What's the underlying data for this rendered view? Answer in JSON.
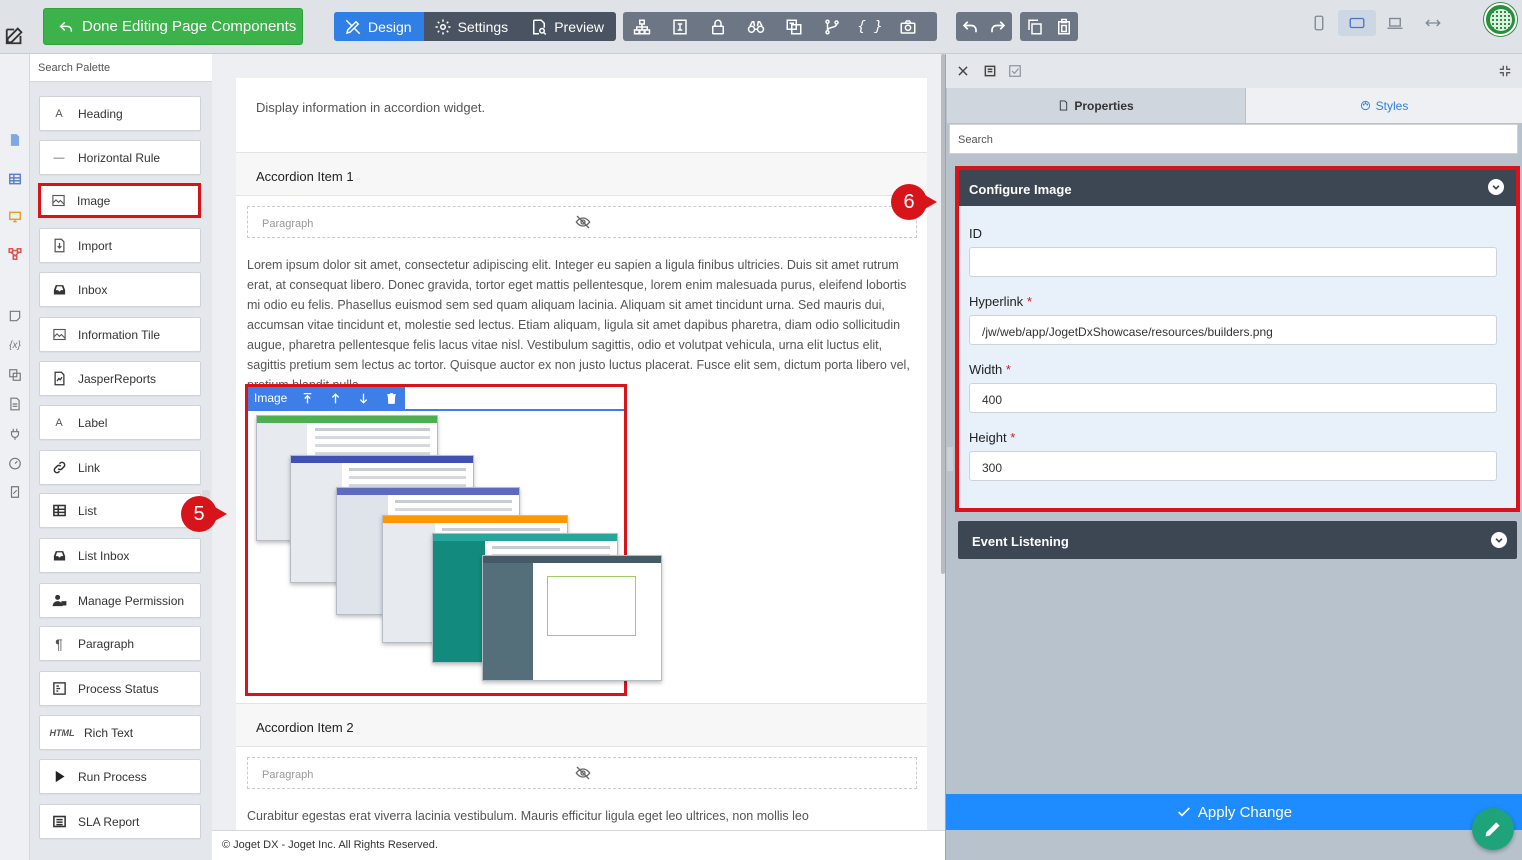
{
  "topbar": {
    "done_label": "Done Editing Page Components",
    "modes": [
      {
        "label": "Design",
        "active": true
      },
      {
        "label": "Settings",
        "active": false
      },
      {
        "label": "Preview",
        "active": false
      }
    ],
    "tools": [
      "sitemap-icon",
      "form-icon",
      "lock-icon",
      "binoculars-icon",
      "translate-icon",
      "branch-icon",
      "code-braces-icon",
      "camera-icon"
    ],
    "history_tools": [
      "undo-icon",
      "redo-icon"
    ],
    "clipboard_tools": [
      "copy-icon",
      "paste-icon"
    ],
    "devices": [
      "phone-icon",
      "tablet-icon",
      "laptop-icon",
      "expand-icon"
    ],
    "active_device": "tablet-icon",
    "accent_color": "#2f7fe6",
    "done_color": "#3bb34a"
  },
  "palette": {
    "search_placeholder": "Search Palette",
    "items": [
      {
        "label": "Heading",
        "icon": "heading-icon",
        "glyph": "A"
      },
      {
        "label": "Horizontal Rule",
        "icon": "horizontal-rule-icon",
        "glyph": "—"
      },
      {
        "label": "Image",
        "icon": "image-icon",
        "glyph": ""
      },
      {
        "label": "Import",
        "icon": "import-icon",
        "glyph": ""
      },
      {
        "label": "Inbox",
        "icon": "inbox-icon",
        "glyph": ""
      },
      {
        "label": "Information Tile",
        "icon": "information-tile-icon",
        "glyph": ""
      },
      {
        "label": "JasperReports",
        "icon": "jasperreports-icon",
        "glyph": ""
      },
      {
        "label": "Label",
        "icon": "label-icon",
        "glyph": "A"
      },
      {
        "label": "Link",
        "icon": "link-icon",
        "glyph": ""
      },
      {
        "label": "List",
        "icon": "list-icon",
        "glyph": ""
      },
      {
        "label": "List Inbox",
        "icon": "list-inbox-icon",
        "glyph": ""
      },
      {
        "label": "Manage Permission",
        "icon": "manage-permission-icon",
        "glyph": ""
      },
      {
        "label": "Paragraph",
        "icon": "paragraph-icon",
        "glyph": "¶"
      },
      {
        "label": "Process Status",
        "icon": "process-status-icon",
        "glyph": ""
      },
      {
        "label": "Rich Text",
        "icon": "rich-text-icon",
        "glyph": "HTML"
      },
      {
        "label": "Run Process",
        "icon": "run-process-icon",
        "glyph": ""
      },
      {
        "label": "SLA Report",
        "icon": "sla-report-icon",
        "glyph": ""
      }
    ],
    "highlighted": "Image"
  },
  "canvas": {
    "description": "Display information in accordion widget.",
    "accordion_items": [
      {
        "title": "Accordion Item 1",
        "paragraph_placeholder": "Paragraph",
        "text": "Lorem ipsum dolor sit amet, consectetur adipiscing elit. Integer eu sapien a ligula finibus ultricies. Duis sit amet rutrum erat, at consequat libero. Donec gravida, tortor eget mattis pellentesque, lorem enim malesuada purus, eleifend lobortis mi odio eu felis. Phasellus euismod sem sed quam aliquam lacinia. Aliquam sit amet tincidunt urna. Sed mauris dui, accumsan vitae tincidunt et, molestie sed lectus. Etiam aliquam, ligula sit amet dapibus pharetra, diam odio sollicitudin augue, pharetra pellentesque felis lacus vitae nisl. Vestibulum sagittis, odio et volutpat vehicula, urna elit luctus elit, sagittis pretium sem lectus ac tortor. Quisque auctor ex non justo luctus placerat. Fusce elit sem, dictum porta libero vel, pretium blandit nulla."
      },
      {
        "title": "Accordion Item 2",
        "paragraph_placeholder": "Paragraph",
        "text": "Curabitur egestas erat viverra lacinia vestibulum. Mauris efficitur ligula eget leo ultrices, non mollis leo"
      }
    ],
    "image_component": {
      "label": "Image",
      "actions": [
        "move-top-icon",
        "move-up-icon",
        "move-down-icon",
        "trash-icon"
      ]
    }
  },
  "footer": {
    "text": "© Joget DX - Joget Inc. All Rights Reserved."
  },
  "properties": {
    "tabs": [
      {
        "label": "Properties",
        "active": true
      },
      {
        "label": "Styles",
        "active": false
      }
    ],
    "search_placeholder": "Search",
    "section_title": "Configure Image",
    "fields": [
      {
        "label": "ID",
        "required": false,
        "value": ""
      },
      {
        "label": "Hyperlink",
        "required": true,
        "value": "/jw/web/app/JogetDxShowcase/resources/builders.png"
      },
      {
        "label": "Width",
        "required": true,
        "value": "400"
      },
      {
        "label": "Height",
        "required": true,
        "value": "300"
      }
    ],
    "event_section_title": "Event Listening",
    "apply_label": "Apply Change",
    "apply_color": "#1e8bff"
  },
  "callouts": [
    {
      "number": "5",
      "target": "image-component"
    },
    {
      "number": "6",
      "target": "configure-image-section"
    }
  ]
}
